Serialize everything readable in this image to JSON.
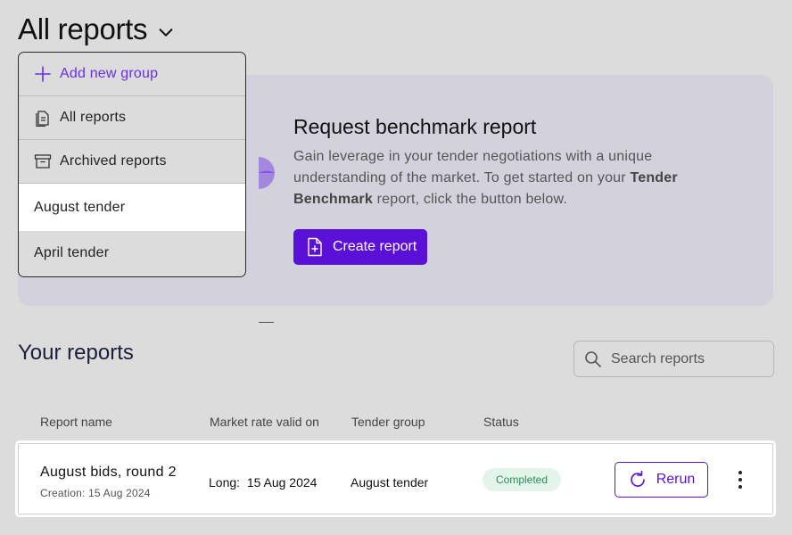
{
  "header": {
    "title": "All reports"
  },
  "dropdown": {
    "items": [
      {
        "label": "Add new group",
        "icon": "plus-icon"
      },
      {
        "label": "All reports",
        "icon": "document-list-icon"
      },
      {
        "label": "Archived reports",
        "icon": "archive-box-icon"
      },
      {
        "label": "August tender",
        "icon": null,
        "selected": true
      },
      {
        "label": "April tender",
        "icon": null
      }
    ]
  },
  "banner": {
    "title": "Request benchmark report",
    "desc_part1": "Gain leverage in your tender negotiations with a unique understanding of the market. To get started on your ",
    "desc_bold": "Tender Benchmark",
    "desc_part2": " report, click the button below.",
    "button_label": "Create report"
  },
  "reports": {
    "title": "Your reports",
    "search_placeholder": "Search reports",
    "columns": [
      "Report name",
      "Market rate valid on",
      "Tender group",
      "Status"
    ],
    "rows": [
      {
        "name": "August bids, round 2",
        "creation": "Creation: 15 Aug 2024",
        "market_rate": "Long:  15 Aug 2024",
        "tender_group": "August tender",
        "status": "Completed",
        "action_label": "Rerun"
      }
    ]
  },
  "colors": {
    "accent": "#5a10d6",
    "add_link": "#6a2ee6",
    "status_completed_bg": "#e3f4ea",
    "status_completed_text": "#2e8b57",
    "page_bg": "#dcdcdc",
    "banner_bg": "#d3d1db"
  }
}
